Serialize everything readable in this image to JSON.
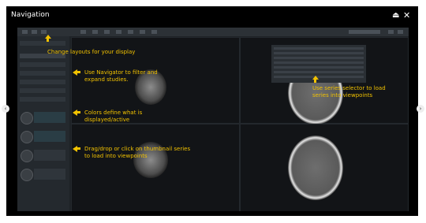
{
  "window": {
    "title": "Navigation"
  },
  "icons": {
    "toggle": "toggle-icon",
    "close": "close-icon",
    "prev": "chevron-left-icon",
    "next": "chevron-right-icon"
  },
  "glyphs": {
    "close": "✕",
    "toggle": "⏏",
    "prev": "‹",
    "next": "›"
  },
  "colors": {
    "accent": "#f2c200",
    "background": "#000000",
    "app": "#1e2226"
  },
  "callouts": [
    {
      "text": "Change layouts for your display"
    },
    {
      "text": "Use Navigator to filter and expand studies."
    },
    {
      "text": "Colors define what is displayed/active"
    },
    {
      "text": "Drag/drop or click on thumbnail series to load into viewpoints"
    },
    {
      "text": "Use series selector to load series into viewpoints"
    }
  ]
}
